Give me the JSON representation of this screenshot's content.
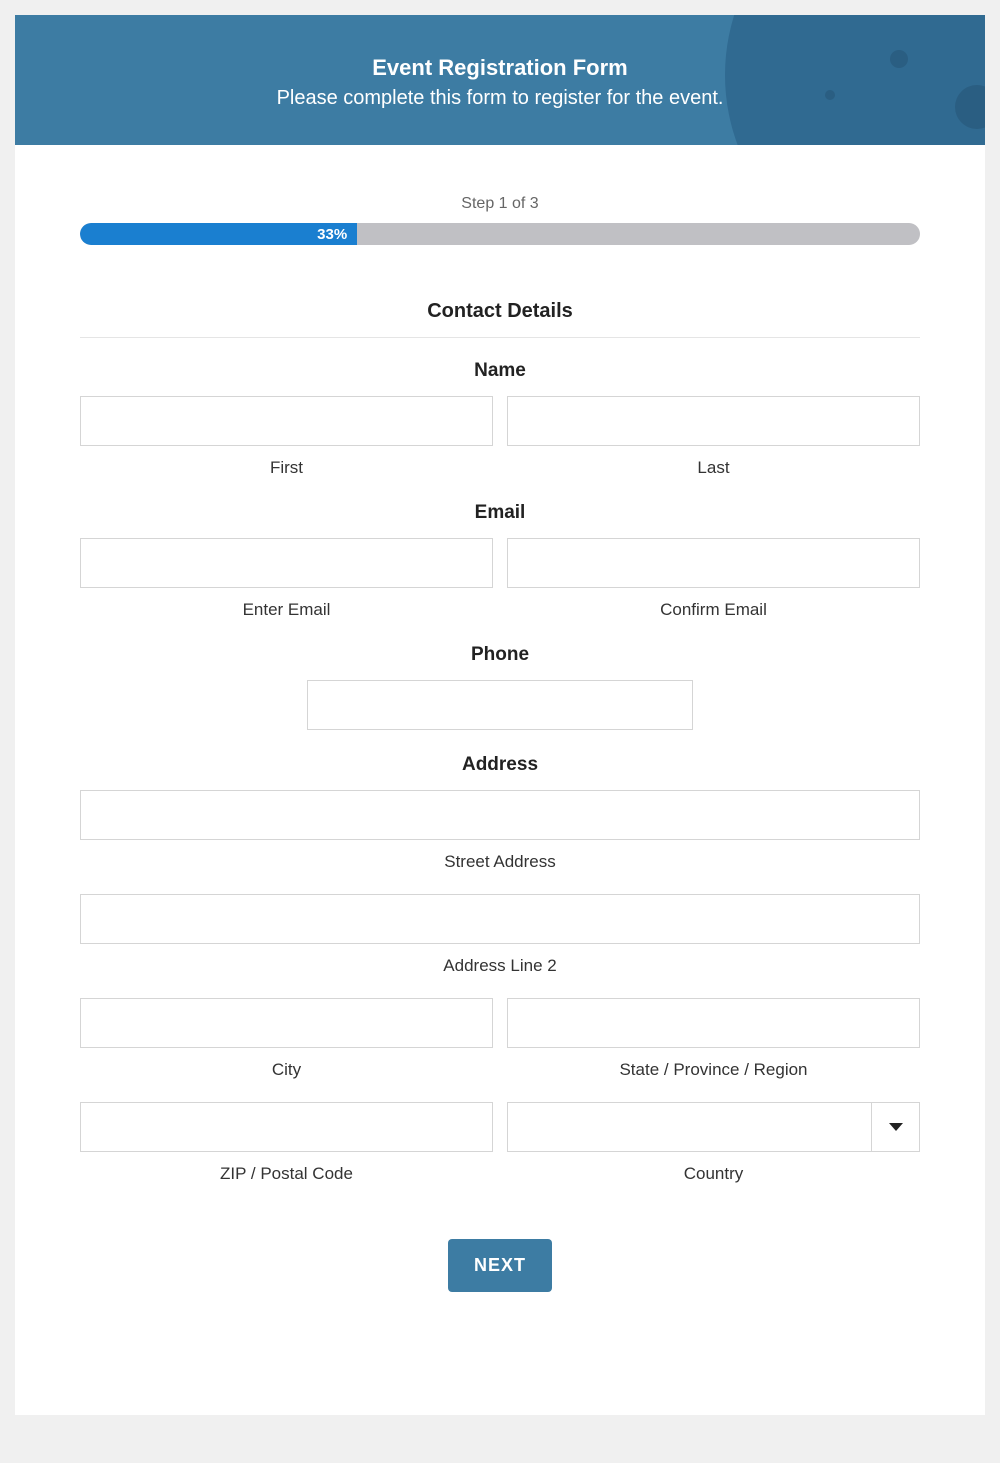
{
  "header": {
    "title": "Event Registration Form",
    "subtitle": "Please complete this form to register for the event."
  },
  "progress": {
    "step_label": "Step 1 of 3",
    "percent_text": "33%",
    "percent_value": 33
  },
  "section": {
    "title": "Contact Details"
  },
  "name": {
    "label": "Name",
    "first_sublabel": "First",
    "last_sublabel": "Last",
    "first_value": "",
    "last_value": ""
  },
  "email": {
    "label": "Email",
    "enter_sublabel": "Enter Email",
    "confirm_sublabel": "Confirm Email",
    "enter_value": "",
    "confirm_value": ""
  },
  "phone": {
    "label": "Phone",
    "value": ""
  },
  "address": {
    "label": "Address",
    "street_sublabel": "Street Address",
    "line2_sublabel": "Address Line 2",
    "city_sublabel": "City",
    "state_sublabel": "State / Province / Region",
    "zip_sublabel": "ZIP / Postal Code",
    "country_sublabel": "Country",
    "street_value": "",
    "line2_value": "",
    "city_value": "",
    "state_value": "",
    "zip_value": "",
    "country_value": ""
  },
  "buttons": {
    "next": "NEXT"
  }
}
